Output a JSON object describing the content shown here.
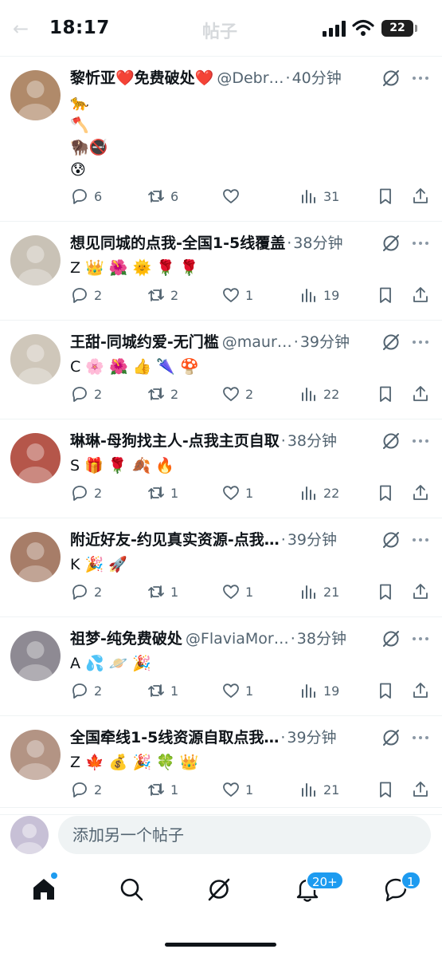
{
  "status_bar": {
    "time": "18:17",
    "battery": "22",
    "faded_title": "帖子"
  },
  "colors": {
    "accent": "#1d9bf0",
    "text": "#0f1419",
    "muted": "#536471",
    "divider": "#eff3f4"
  },
  "posts": [
    {
      "name": "黎忻亚❤️免费破处❤️",
      "handle": "@Debr…",
      "time": "40分钟",
      "body": "🐆\n🪓\n🦬🚭\n😰",
      "replies": "6",
      "reposts": "6",
      "likes": "",
      "views": "31",
      "avatar_color": "#b08a6a"
    },
    {
      "name": "想见同城的点我-全国1-5线覆盖",
      "handle": "",
      "time": "38分钟",
      "body": "Z 👑 🌺 🌞 🌹 🌹",
      "replies": "2",
      "reposts": "2",
      "likes": "1",
      "views": "19",
      "avatar_color": "#c9c2b6"
    },
    {
      "name": "王甜-同城约爱-无门槛",
      "handle": "@maur…",
      "time": "39分钟",
      "body": "C 🌸 🌺 👍 🌂 🍄",
      "replies": "2",
      "reposts": "2",
      "likes": "2",
      "views": "22",
      "avatar_color": "#cfc7ba"
    },
    {
      "name": "琳琳-母狗找主人-点我主页自取",
      "handle": "",
      "time": "38分钟",
      "body": "S 🎁 🌹 🍂 🔥",
      "replies": "2",
      "reposts": "1",
      "likes": "1",
      "views": "22",
      "avatar_color": "#b5564a"
    },
    {
      "name": "附近好友-约见真实资源-点我…",
      "handle": "",
      "time": "39分钟",
      "body": "K 🎉 🚀",
      "replies": "2",
      "reposts": "1",
      "likes": "1",
      "views": "21",
      "avatar_color": "#a77d68"
    },
    {
      "name": "祖梦-纯免费破处",
      "handle": "@FlaviaMor…",
      "time": "38分钟",
      "body": "A 💦 🪐 🎉",
      "replies": "2",
      "reposts": "1",
      "likes": "1",
      "views": "19",
      "avatar_color": "#8e8a93"
    },
    {
      "name": "全国牵线1-5线资源自取点我…",
      "handle": "",
      "time": "39分钟",
      "body": "Z 🍁 💰 🎉 🍀 👑",
      "replies": "2",
      "reposts": "1",
      "likes": "1",
      "views": "21",
      "avatar_color": "#b39484"
    }
  ],
  "compose": {
    "placeholder": "添加另一个帖子",
    "avatar_color": "#c7c0d6"
  },
  "tabbar": {
    "notif_badge": "20+",
    "msgs_badge": "1"
  },
  "icons": {
    "post_grok": "grok-icon",
    "post_more": "more-icon",
    "reply": "reply-icon",
    "repost": "repost-icon",
    "like": "heart-icon",
    "views": "views-icon",
    "bookmark": "bookmark-icon",
    "share": "share-icon",
    "home": "home-icon",
    "search": "search-icon",
    "grok": "grok-icon",
    "notifications": "bell-icon",
    "messages": "messages-icon"
  }
}
